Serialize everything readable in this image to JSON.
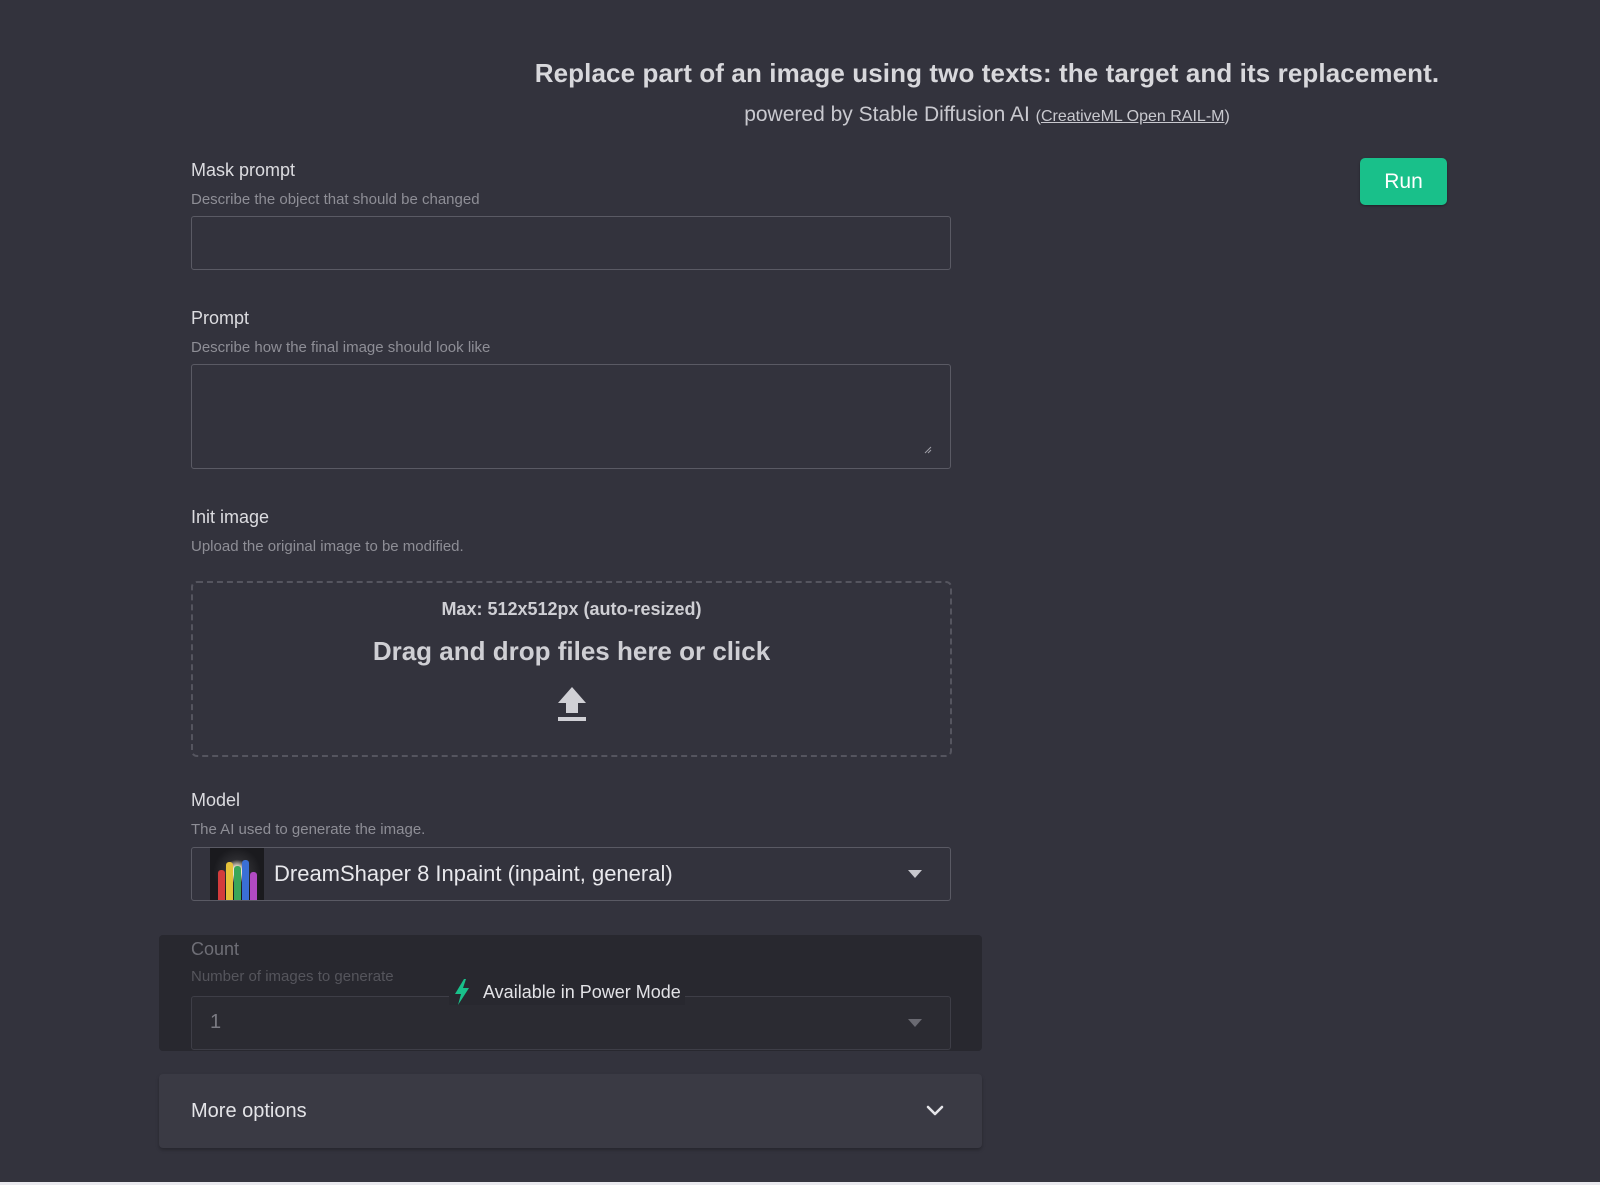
{
  "header": {
    "title": "Replace part of an image using two texts: the target and its replacement.",
    "powered_by": "powered by Stable Diffusion AI",
    "license_open": "(",
    "license_link": "CreativeML Open RAIL-M",
    "license_close": ")"
  },
  "run_button": {
    "label": "Run"
  },
  "mask_prompt": {
    "label": "Mask prompt",
    "help": "Describe the object that should be changed",
    "value": ""
  },
  "prompt": {
    "label": "Prompt",
    "help": "Describe how the final image should look like",
    "value": ""
  },
  "init_image": {
    "label": "Init image",
    "help": "Upload the original image to be modified.",
    "max_note": "Max: 512x512px (auto-resized)",
    "dropzone_text": "Drag and drop files here or click",
    "icon": "upload-icon"
  },
  "model": {
    "label": "Model",
    "help": "The AI used to generate the image.",
    "selected": "DreamShaper 8 Inpaint (inpaint, general)"
  },
  "count": {
    "label": "Count",
    "help": "Number of images to generate",
    "selected": "1",
    "power_mode_text": "Available in Power Mode"
  },
  "more_options": {
    "label": "More options"
  },
  "colors": {
    "accent": "#19c08a",
    "background": "#33333d",
    "panel": "#28282f"
  }
}
